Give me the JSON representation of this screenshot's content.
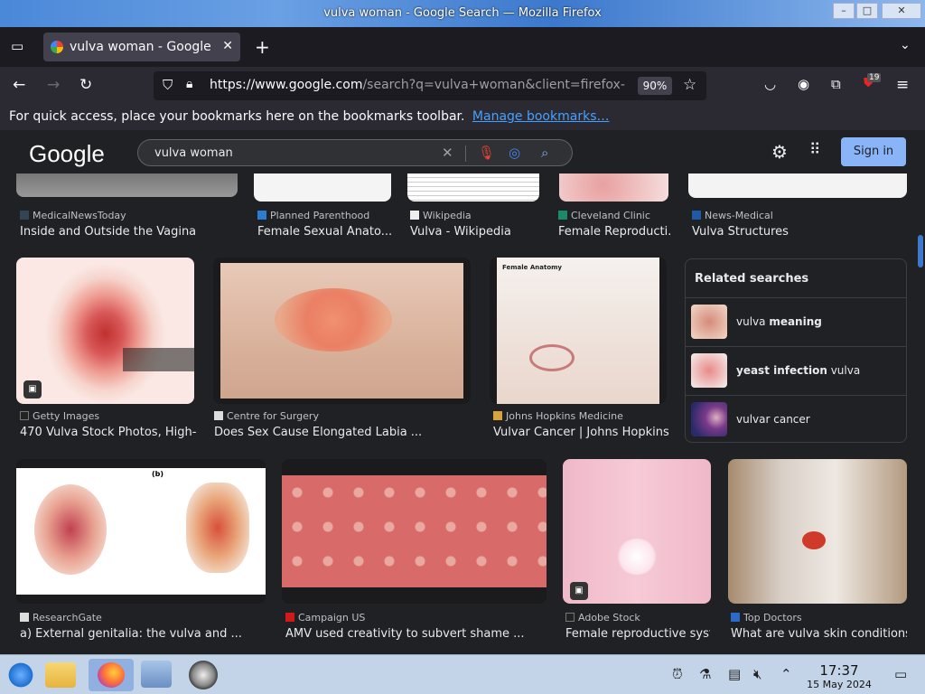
{
  "window": {
    "title": "vulva woman - Google Search — Mozilla Firefox"
  },
  "tab": {
    "label": "vulva woman - Google Search",
    "close": "✕",
    "new_tab": "+"
  },
  "nav": {
    "url_host": "https://www.google.com",
    "url_path": "/search?q=vulva+woman&client=firefox-b",
    "zoom": "90%",
    "ext_badge": "19"
  },
  "bookmarks": {
    "hint": "For quick access, place your bookmarks here on the bookmarks toolbar.",
    "link": "Manage bookmarks…"
  },
  "google": {
    "logo": "Google",
    "query": "vulva woman",
    "signin": "Sign in"
  },
  "row1": [
    {
      "source": "MedicalNewsToday",
      "caption": "Inside and Outside the Vagina"
    },
    {
      "source": "Planned Parenthood",
      "caption": "Female Sexual Anato..."
    },
    {
      "source": "Wikipedia",
      "caption": "Vulva - Wikipedia"
    },
    {
      "source": "Cleveland Clinic",
      "caption": "Female Reproducti..."
    },
    {
      "source": "News-Medical",
      "caption": "Vulva Structures"
    }
  ],
  "row2": [
    {
      "source": "Getty Images",
      "caption": "470 Vulva Stock Photos, High-..."
    },
    {
      "source": "Centre for Surgery",
      "caption": "Does Sex Cause Elongated Labia ..."
    },
    {
      "source": "Johns Hopkins Medicine",
      "caption": "Vulvar Cancer | Johns Hopkins..."
    }
  ],
  "image_text": {
    "anatomy_title": "Female Anatomy",
    "label_b": "(b)"
  },
  "related": {
    "title": "Related searches",
    "items": [
      {
        "plain": "vulva ",
        "bold": "meaning",
        "after": ""
      },
      {
        "plain": "",
        "bold": "yeast infection",
        "after": " vulva"
      },
      {
        "plain": "vulvar cancer",
        "bold": "",
        "after": ""
      }
    ]
  },
  "row3": [
    {
      "source": "ResearchGate",
      "caption": "a) External genitalia: the vulva and ..."
    },
    {
      "source": "Campaign US",
      "caption": "AMV used creativity to subvert shame ..."
    },
    {
      "source": "Adobe Stock",
      "caption": "Female reproductive syst..."
    },
    {
      "source": "Top Doctors",
      "caption": "What are vulva skin conditions ..."
    }
  ],
  "taskbar": {
    "time": "17:37",
    "date": "15 May 2024"
  }
}
